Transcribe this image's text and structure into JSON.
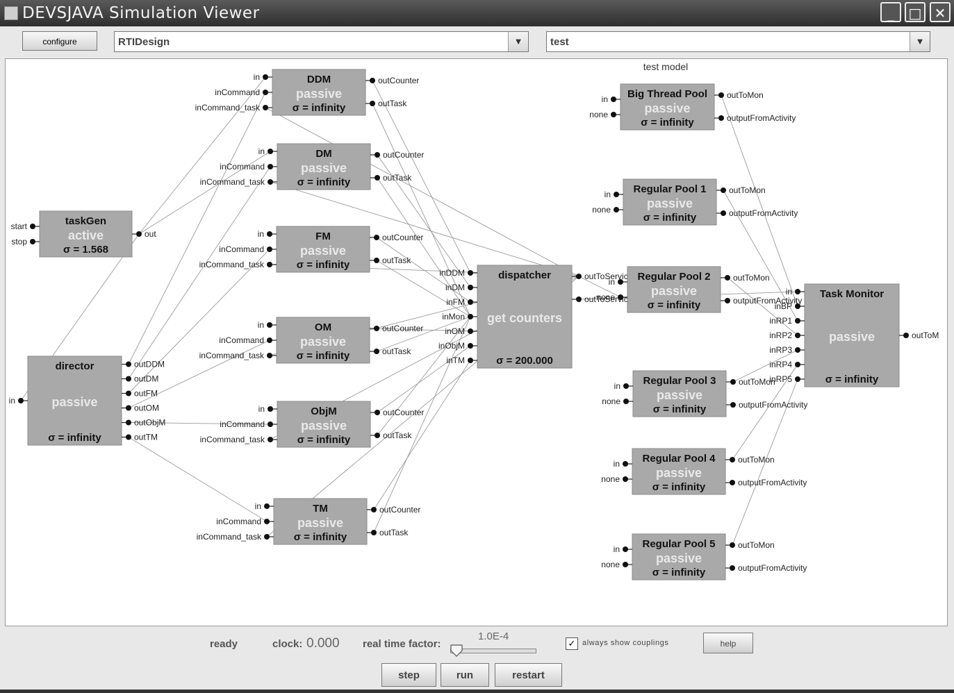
{
  "window": {
    "title": "DEVSJAVA Simulation Viewer",
    "controls": [
      "_",
      "□",
      "✕"
    ]
  },
  "toolbar": {
    "configure_label": "configure",
    "package_value": "RTIDesign",
    "model_value": "test"
  },
  "canvas": {
    "model_name": "test model"
  },
  "components": [
    {
      "id": "ddm",
      "name": "DDM",
      "phase": "passive",
      "sigma": "σ = infinity",
      "in_ports": [
        "in",
        "inCommand",
        "inCommand_task"
      ],
      "out_ports": [
        "outCounter",
        "outTask"
      ]
    },
    {
      "id": "dm",
      "name": "DM",
      "phase": "passive",
      "sigma": "σ = infinity",
      "in_ports": [
        "in",
        "inCommand",
        "inCommand_task"
      ],
      "out_ports": [
        "outCounter",
        "outTask"
      ]
    },
    {
      "id": "fm",
      "name": "FM",
      "phase": "passive",
      "sigma": "σ = infinity",
      "in_ports": [
        "in",
        "inCommand",
        "inCommand_task"
      ],
      "out_ports": [
        "outCounter",
        "outTask"
      ]
    },
    {
      "id": "om",
      "name": "OM",
      "phase": "passive",
      "sigma": "σ = infinity",
      "in_ports": [
        "in",
        "inCommand",
        "inCommand_task"
      ],
      "out_ports": [
        "outCounter",
        "outTask"
      ]
    },
    {
      "id": "objm",
      "name": "ObjM",
      "phase": "passive",
      "sigma": "σ = infinity",
      "in_ports": [
        "in",
        "inCommand",
        "inCommand_task"
      ],
      "out_ports": [
        "outCounter",
        "outTask"
      ]
    },
    {
      "id": "tm",
      "name": "TM",
      "phase": "passive",
      "sigma": "σ = infinity",
      "in_ports": [
        "in",
        "inCommand",
        "inCommand_task"
      ],
      "out_ports": [
        "outCounter",
        "outTask"
      ]
    },
    {
      "id": "taskgen",
      "name": "taskGen",
      "phase": "active",
      "sigma": "σ = 1.568",
      "in_ports": [
        "start",
        "stop"
      ],
      "out_ports": [
        "out"
      ]
    },
    {
      "id": "director",
      "name": "director",
      "phase": "passive",
      "sigma": "σ = infinity",
      "in_ports": [
        "in"
      ],
      "out_ports": [
        "outDDM",
        "outDM",
        "outFM",
        "outOM",
        "outObjM",
        "outTM"
      ]
    },
    {
      "id": "dispatcher",
      "name": "dispatcher",
      "phase": "get counters",
      "sigma": "σ = 200.000",
      "in_ports": [
        "inDDM",
        "inDM",
        "inFM",
        "inMon",
        "inOM",
        "inObjM",
        "inTM"
      ],
      "out_ports": [
        "outToService",
        "outToService_task"
      ]
    },
    {
      "id": "bigpool",
      "name": "Big Thread Pool",
      "phase": "passive",
      "sigma": "σ = infinity",
      "in_ports": [
        "in",
        "none"
      ],
      "out_ports": [
        "outToMon",
        "outputFromActivity"
      ]
    },
    {
      "id": "pool1",
      "name": "Regular Pool 1",
      "phase": "passive",
      "sigma": "σ = infinity",
      "in_ports": [
        "in",
        "none"
      ],
      "out_ports": [
        "outToMon",
        "outputFromActivity"
      ]
    },
    {
      "id": "pool2",
      "name": "Regular Pool 2",
      "phase": "passive",
      "sigma": "σ = infinity",
      "in_ports": [
        "in",
        "none"
      ],
      "out_ports": [
        "outToMon",
        "outputFromActivity"
      ]
    },
    {
      "id": "pool3",
      "name": "Regular Pool 3",
      "phase": "passive",
      "sigma": "σ = infinity",
      "in_ports": [
        "in",
        "none"
      ],
      "out_ports": [
        "outToMon",
        "outputFromActivity"
      ]
    },
    {
      "id": "pool4",
      "name": "Regular Pool 4",
      "phase": "passive",
      "sigma": "σ = infinity",
      "in_ports": [
        "in",
        "none"
      ],
      "out_ports": [
        "outToMon",
        "outputFromActivity"
      ]
    },
    {
      "id": "pool5",
      "name": "Regular Pool 5",
      "phase": "passive",
      "sigma": "σ = infinity",
      "in_ports": [
        "in",
        "none"
      ],
      "out_ports": [
        "outToMon",
        "outputFromActivity"
      ]
    },
    {
      "id": "monitor",
      "name": "Task Monitor",
      "phase": "passive",
      "sigma": "σ = infinity",
      "in_ports": [
        "in",
        "inBP",
        "inRP1",
        "inRP2",
        "inRP3",
        "inRP4",
        "inRP5"
      ],
      "out_ports": [
        "outToM"
      ]
    }
  ],
  "couplings": [
    [
      "director",
      "outDDM",
      "ddm",
      "inCommand"
    ],
    [
      "director",
      "outDM",
      "dm",
      "inCommand"
    ],
    [
      "director",
      "outFM",
      "fm",
      "inCommand"
    ],
    [
      "director",
      "outOM",
      "om",
      "inCommand"
    ],
    [
      "director",
      "outObjM",
      "objm",
      "inCommand"
    ],
    [
      "director",
      "outTM",
      "tm",
      "inCommand"
    ],
    [
      "ddm",
      "outCounter",
      "dispatcher",
      "inDDM"
    ],
    [
      "dm",
      "outCounter",
      "dispatcher",
      "inDM"
    ],
    [
      "fm",
      "outCounter",
      "dispatcher",
      "inFM"
    ],
    [
      "om",
      "outCounter",
      "dispatcher",
      "inOM"
    ],
    [
      "objm",
      "outCounter",
      "dispatcher",
      "inObjM"
    ],
    [
      "tm",
      "outCounter",
      "dispatcher",
      "inTM"
    ],
    [
      "dispatcher",
      "outToService",
      "ddm",
      "inCommand_task"
    ],
    [
      "dispatcher",
      "outToService",
      "dm",
      "inCommand_task"
    ],
    [
      "dispatcher",
      "outToService",
      "fm",
      "inCommand_task"
    ],
    [
      "dispatcher",
      "outToService",
      "om",
      "inCommand_task"
    ],
    [
      "dispatcher",
      "outToService",
      "objm",
      "inCommand_task"
    ],
    [
      "dispatcher",
      "outToService",
      "tm",
      "inCommand_task"
    ],
    [
      "ddm",
      "outTask",
      "dispatcher",
      "inMon"
    ],
    [
      "dm",
      "outTask",
      "dispatcher",
      "inMon"
    ],
    [
      "fm",
      "outTask",
      "dispatcher",
      "inMon"
    ],
    [
      "om",
      "outTask",
      "dispatcher",
      "inMon"
    ],
    [
      "objm",
      "outTask",
      "dispatcher",
      "inMon"
    ],
    [
      "tm",
      "outTask",
      "dispatcher",
      "inMon"
    ],
    [
      "taskgen",
      "out",
      "ddm",
      "in"
    ],
    [
      "taskgen",
      "out",
      "dm",
      "in"
    ],
    [
      "taskgen",
      "out",
      "director",
      "in"
    ],
    [
      "dispatcher",
      "outToService_task",
      "monitor",
      "in"
    ],
    [
      "bigpool",
      "outToMon",
      "monitor",
      "inBP"
    ],
    [
      "pool1",
      "outToMon",
      "monitor",
      "inRP1"
    ],
    [
      "pool2",
      "outToMon",
      "monitor",
      "inRP2"
    ],
    [
      "pool3",
      "outToMon",
      "monitor",
      "inRP3"
    ],
    [
      "pool4",
      "outToMon",
      "monitor",
      "inRP4"
    ],
    [
      "pool5",
      "outToMon",
      "monitor",
      "inRP5"
    ],
    [
      "dispatcher",
      "outToService",
      "pool2",
      "none"
    ]
  ],
  "status": {
    "state": "ready",
    "clock_label": "clock:",
    "clock_value": "0.000",
    "rtf_label": "real time factor:",
    "rtf_value": "1.0E-4"
  },
  "controls": {
    "always_show_label": "always show couplings",
    "always_show_checked": true,
    "help_label": "help",
    "step_label": "step",
    "run_label": "run",
    "restart_label": "restart"
  }
}
